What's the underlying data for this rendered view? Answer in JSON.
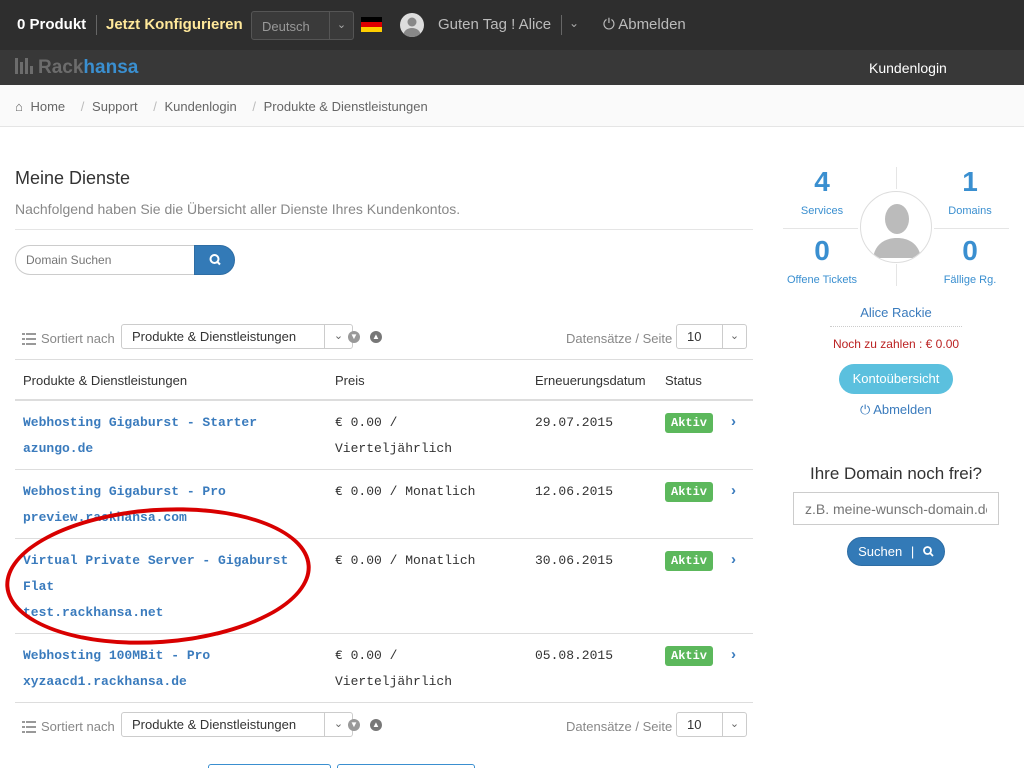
{
  "topbar": {
    "products": "0 Produkt",
    "configure": "Jetzt Konfigurieren",
    "language": "Deutsch",
    "greeting": "Guten Tag ! Alice",
    "logout": "Abmelden"
  },
  "brand": {
    "rack": "Rack",
    "hansa": "hansa"
  },
  "nav": {
    "kundenlogin": "Kundenlogin"
  },
  "breadcrumb": [
    "Home",
    "Support",
    "Kundenlogin",
    "Produkte & Dienstleistungen"
  ],
  "main": {
    "title": "Meine Dienste",
    "subtitle": "Nachfolgend haben Sie die Übersicht aller Dienste Ihres Kundenkontos.",
    "search_placeholder": "Domain Suchen"
  },
  "sortbar": {
    "sort_label": "Sortiert nach",
    "sort_value": "Produkte & Dienstleistungen",
    "per_page_label": "Datensätze / Seite",
    "per_page_value": "10"
  },
  "table": {
    "headers": [
      "Produkte & Dienstleistungen",
      "Preis",
      "Erneuerungsdatum",
      "Status"
    ],
    "rows": [
      {
        "name": "Webhosting Gigaburst - Starter",
        "domain": "azungo.de",
        "price": "€ 0.00 / Vierteljährlich",
        "date": "29.07.2015",
        "status": "Aktiv"
      },
      {
        "name": "Webhosting Gigaburst - Pro",
        "domain": "preview.rackhansa.com",
        "price": "€ 0.00 / Monatlich",
        "date": "12.06.2015",
        "status": "Aktiv"
      },
      {
        "name": "Virtual Private Server - Gigaburst Flat",
        "domain": "test.rackhansa.net",
        "price": "€ 0.00 / Monatlich",
        "date": "30.06.2015",
        "status": "Aktiv"
      },
      {
        "name": "Webhosting 100MBit - Pro",
        "domain": "xyzaacd1.rackhansa.de",
        "price": "€ 0.00 / Vierteljährlich",
        "date": "05.08.2015",
        "status": "Aktiv"
      }
    ]
  },
  "sidebar": {
    "stats": [
      {
        "value": "4",
        "label": "Services"
      },
      {
        "value": "1",
        "label": "Domains"
      },
      {
        "value": "0",
        "label": "Offene Tickets"
      },
      {
        "value": "0",
        "label": "Fällige Rg."
      }
    ],
    "name": "Alice Rackie",
    "due": "Noch zu zahlen : € 0.00",
    "account_button": "Kontoübersicht",
    "logout": "Abmelden",
    "domain_heading": "Ihre Domain noch frei?",
    "domain_placeholder": "z.B. meine-wunsch-domain.de",
    "domain_button": "Suchen"
  },
  "colors": {
    "accent": "#3a8fd0",
    "status_active": "#5cb85c",
    "annotation": "#d80000"
  }
}
